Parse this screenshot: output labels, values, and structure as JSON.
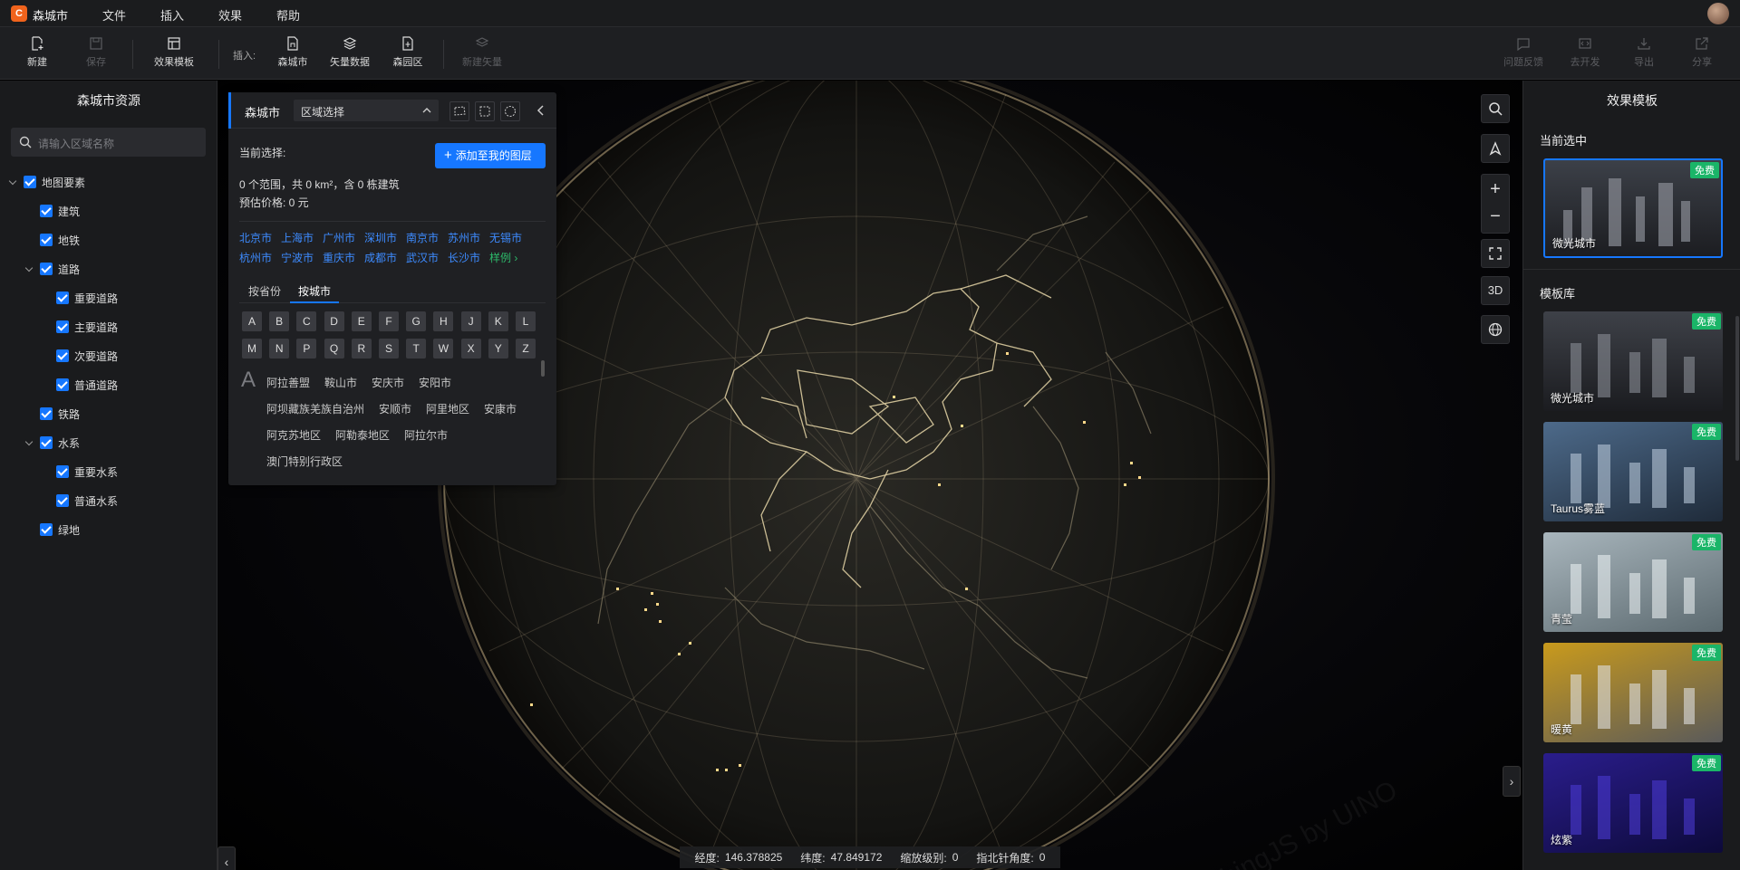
{
  "app": {
    "logo_glyph": "C",
    "name": "森城市"
  },
  "menu": [
    "文件",
    "插入",
    "效果",
    "帮助"
  ],
  "toolbar": {
    "new": "新建",
    "save": "保存",
    "effect_template": "效果模板",
    "insert_label": "插入:",
    "sencity": "森城市",
    "vector_data": "矢量数据",
    "park": "森园区",
    "new_vector": "新建矢量",
    "feedback": "问题反馈",
    "develop": "去开发",
    "export": "导出",
    "share": "分享"
  },
  "left_panel": {
    "title": "森城市资源",
    "search_placeholder": "请输入区域名称",
    "tree": [
      {
        "label": "地图要素",
        "level": 0,
        "expandable": true,
        "checked": true
      },
      {
        "label": "建筑",
        "level": 1,
        "expandable": false,
        "checked": true
      },
      {
        "label": "地铁",
        "level": 1,
        "expandable": false,
        "checked": true
      },
      {
        "label": "道路",
        "level": 1,
        "expandable": true,
        "checked": true
      },
      {
        "label": "重要道路",
        "level": 2,
        "expandable": false,
        "checked": true
      },
      {
        "label": "主要道路",
        "level": 2,
        "expandable": false,
        "checked": true
      },
      {
        "label": "次要道路",
        "level": 2,
        "expandable": false,
        "checked": true
      },
      {
        "label": "普通道路",
        "level": 2,
        "expandable": false,
        "checked": true
      },
      {
        "label": "铁路",
        "level": 1,
        "expandable": false,
        "checked": true
      },
      {
        "label": "水系",
        "level": 1,
        "expandable": true,
        "checked": true
      },
      {
        "label": "重要水系",
        "level": 2,
        "expandable": false,
        "checked": true
      },
      {
        "label": "普通水系",
        "level": 2,
        "expandable": false,
        "checked": true
      },
      {
        "label": "绿地",
        "level": 1,
        "expandable": false,
        "checked": true
      }
    ]
  },
  "region_panel": {
    "title": "森城市",
    "select_value": "区域选择",
    "current_label": "当前选择:",
    "add_button": "添加至我的图层",
    "summary": "0 个范围，共 0 km²，含 0 栋建筑",
    "price": "预估价格: 0 元",
    "quick_cities": [
      "北京市",
      "上海市",
      "广州市",
      "深圳市",
      "南京市",
      "苏州市",
      "无锡市",
      "杭州市",
      "宁波市",
      "重庆市",
      "成都市",
      "武汉市",
      "长沙市"
    ],
    "sample_link": "样例 ›",
    "tabs": [
      "按省份",
      "按城市"
    ],
    "active_tab": "按城市",
    "letters": [
      "A",
      "B",
      "C",
      "D",
      "E",
      "F",
      "G",
      "H",
      "J",
      "K",
      "L",
      "M",
      "N",
      "P",
      "Q",
      "R",
      "S",
      "T",
      "W",
      "X",
      "Y",
      "Z"
    ],
    "group_letter": "A",
    "group_cities": [
      "阿拉善盟",
      "鞍山市",
      "安庆市",
      "安阳市",
      "阿坝藏族羌族自治州",
      "安顺市",
      "阿里地区",
      "安康市",
      "阿克苏地区",
      "阿勒泰地区",
      "阿拉尔市",
      "澳门特别行政区"
    ]
  },
  "map_controls": {
    "three_d": "3D"
  },
  "watermark": "ThingJS by UINO",
  "right_panel": {
    "title": "效果模板",
    "current_label": "当前选中",
    "current": {
      "name": "微光城市",
      "badge": "免费"
    },
    "library_label": "模板库",
    "templates": [
      {
        "name": "微光城市",
        "badge": "免费"
      },
      {
        "name": "Taurus雾蓝",
        "badge": "免费"
      },
      {
        "name": "青莹",
        "badge": "免费"
      },
      {
        "name": "暖黄",
        "badge": "免费"
      },
      {
        "name": "炫紫",
        "badge": "免费"
      }
    ]
  },
  "status": {
    "lon_label": "经度:",
    "lon": "146.378825",
    "lat_label": "纬度:",
    "lat": "47.849172",
    "zoom_label": "缩放级别:",
    "zoom": "0",
    "compass_label": "指北针角度:",
    "compass": "0"
  },
  "colors": {
    "accent": "#1677ff",
    "free_badge": "#1ab568",
    "logo": "#f0631c",
    "globe_line": "#d9c49a"
  }
}
